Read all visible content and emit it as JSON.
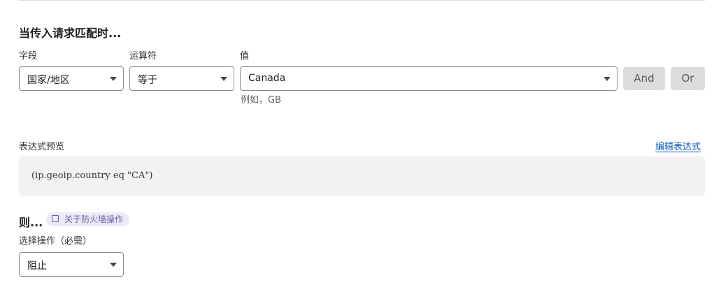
{
  "rule": {
    "when_heading": "当传入请求匹配时...",
    "field_label": "字段",
    "operator_label": "运算符",
    "value_label": "值",
    "field_value": "国家/地区",
    "operator_value": "等于",
    "value_value": "Canada",
    "value_hint": "例如，GB",
    "and_label": "And",
    "or_label": "Or"
  },
  "expression": {
    "preview_label": "表达式预览",
    "edit_link": "编辑表达式",
    "code": "(ip.geoip.country eq \"CA\")"
  },
  "then": {
    "heading": "则...",
    "info_pill": "关于防火墙操作",
    "info_icon": "book-icon",
    "action_label": "选择操作（必需）",
    "action_value": "阻止"
  },
  "colors": {
    "link": "#0b57b8",
    "button_bg": "#dcdcdc",
    "preview_bg": "#f2f2f2",
    "pill_bg": "#ede9f7",
    "pill_text": "#6b5fa8"
  }
}
